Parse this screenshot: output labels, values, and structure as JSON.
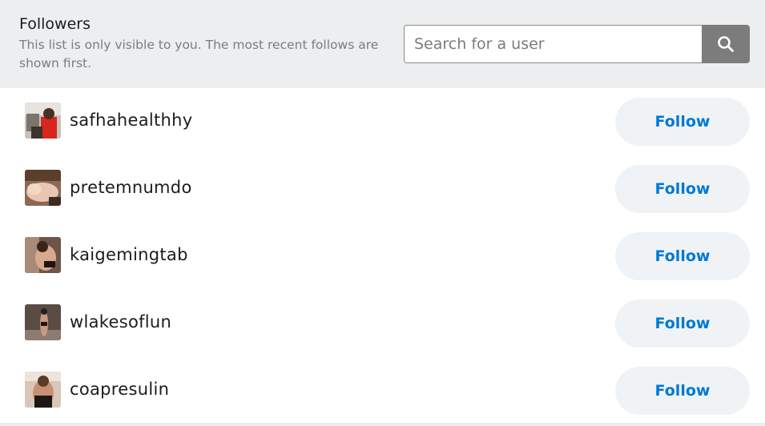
{
  "header": {
    "title": "Followers",
    "description": "This list is only visible to you. The most recent follows are shown first."
  },
  "search": {
    "placeholder": "Search for a user",
    "icon": "search-icon"
  },
  "followers": [
    {
      "username": "safhahealthhy",
      "button_label": "Follow"
    },
    {
      "username": "pretemnumdo",
      "button_label": "Follow"
    },
    {
      "username": "kaigemingtab",
      "button_label": "Follow"
    },
    {
      "username": "wlakesoflun",
      "button_label": "Follow"
    },
    {
      "username": "coapresulin",
      "button_label": "Follow"
    }
  ],
  "colors": {
    "header_bg": "#edeef0",
    "accent": "#0079d3",
    "button_bg": "#eff3f6",
    "search_button_bg": "#7c7c7c",
    "text": "#1c1c1c",
    "muted_text": "#7c7c7c"
  }
}
